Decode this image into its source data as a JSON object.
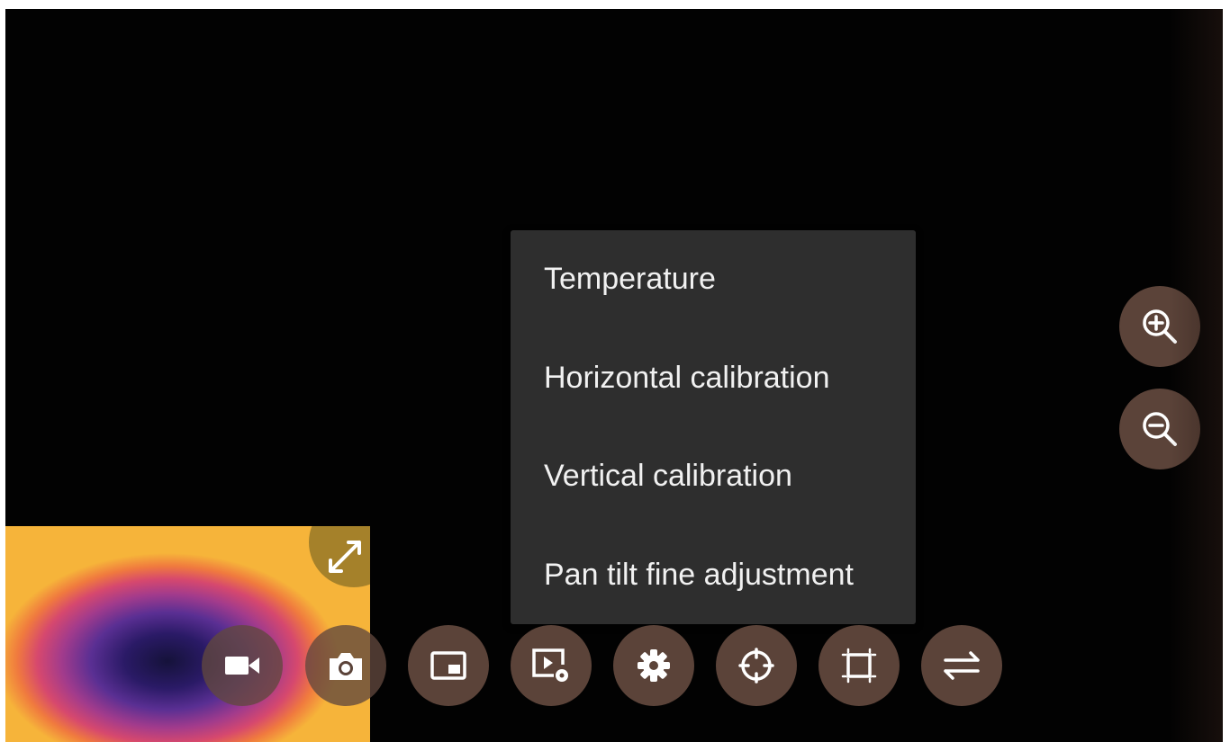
{
  "menu": {
    "items": [
      {
        "label": "Temperature"
      },
      {
        "label": "Horizontal calibration"
      },
      {
        "label": "Vertical calibration"
      },
      {
        "label": "Pan tilt fine adjustment"
      }
    ]
  },
  "zoom_controls": [
    "zoom-in-icon",
    "zoom-out-icon"
  ],
  "toolbar": {
    "icons": [
      "video-camera-icon",
      "camera-icon",
      "picture-in-picture-icon",
      "playback-settings-icon",
      "gear-icon",
      "crosshair-icon",
      "crop-frame-icon",
      "swap-arrows-icon"
    ]
  },
  "pip": {
    "icon": "expand-icon"
  },
  "colors": {
    "button_bg": "#5b4339",
    "menu_bg": "#2e2e2e",
    "menu_text": "#f1f1f1"
  }
}
